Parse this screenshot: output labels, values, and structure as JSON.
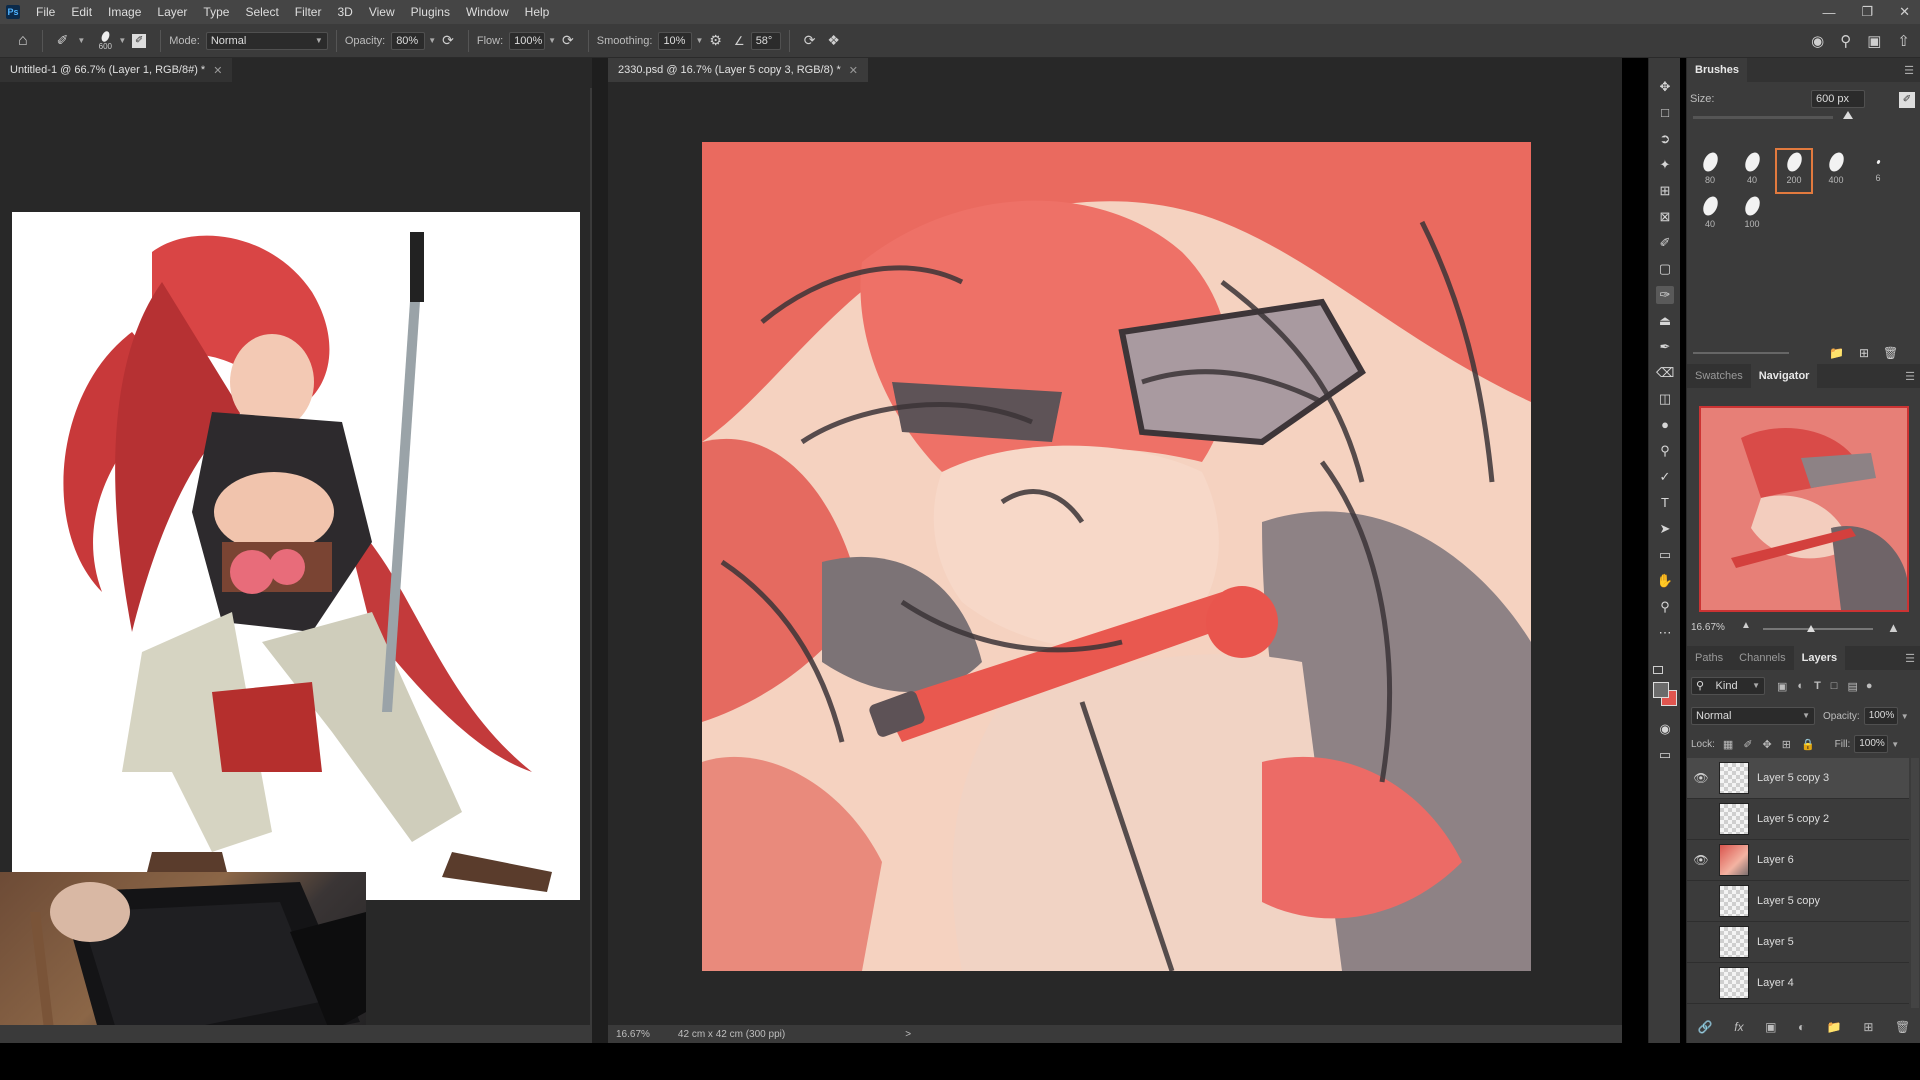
{
  "app": {
    "logo": "Ps",
    "menu": [
      "File",
      "Edit",
      "Image",
      "Layer",
      "Type",
      "Select",
      "Filter",
      "3D",
      "View",
      "Plugins",
      "Window",
      "Help"
    ]
  },
  "options": {
    "brush_size": "600",
    "mode_label": "Mode:",
    "mode_value": "Normal",
    "opacity_label": "Opacity:",
    "opacity_value": "80%",
    "flow_label": "Flow:",
    "flow_value": "100%",
    "smoothing_label": "Smoothing:",
    "smoothing_value": "10%",
    "angle_value": "58°"
  },
  "tabs": {
    "left": "Untitled-1 @ 66.7% (Layer 1, RGB/8#) *",
    "main": "2330.psd @ 16.7% (Layer 5 copy 3, RGB/8) *"
  },
  "status": {
    "zoom": "16.67%",
    "doc_size": "42 cm x 42 cm (300 ppi)",
    "arrow": ">"
  },
  "brushes": {
    "tab": "Brushes",
    "size_label": "Size:",
    "size_value": "600 px",
    "presets": [
      "80",
      "40",
      "200",
      "400",
      "6",
      "40",
      "100"
    ],
    "selected": "200"
  },
  "navigator": {
    "tabs": [
      "Swatches",
      "Navigator"
    ],
    "active": "Navigator",
    "zoom": "16.67%"
  },
  "layers": {
    "tabs": [
      "Paths",
      "Channels",
      "Layers"
    ],
    "active": "Layers",
    "filter": "Kind",
    "blend_mode": "Normal",
    "opacity_label": "Opacity:",
    "opacity_value": "100%",
    "lock_label": "Lock:",
    "fill_label": "Fill:",
    "fill_value": "100%",
    "items": [
      {
        "name": "Layer 5 copy 3",
        "visible": true,
        "selected": true
      },
      {
        "name": "Layer 5 copy 2",
        "visible": false,
        "selected": false
      },
      {
        "name": "Layer 6",
        "visible": true,
        "selected": false
      },
      {
        "name": "Layer 5 copy",
        "visible": false,
        "selected": false
      },
      {
        "name": "Layer 5",
        "visible": false,
        "selected": false
      },
      {
        "name": "Layer 4",
        "visible": false,
        "selected": false
      }
    ]
  },
  "colors": {
    "accent": "#e27a3e",
    "foreground": "#6b6b6b",
    "background": "#e0554f"
  }
}
